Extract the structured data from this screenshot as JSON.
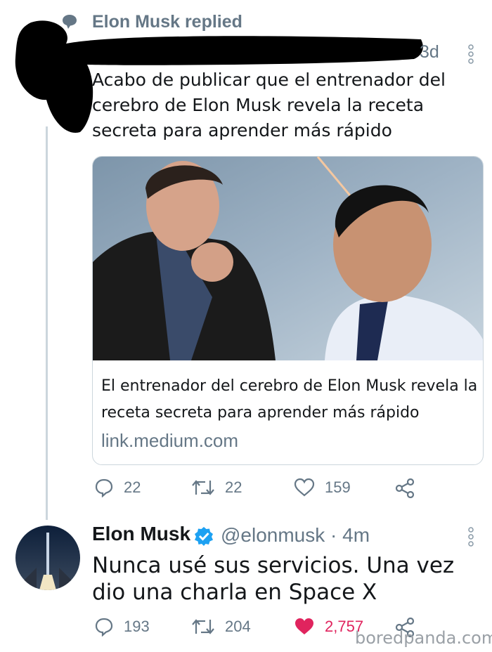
{
  "reply_header": {
    "label": "Elon Musk replied",
    "time": "3d"
  },
  "tweet1": {
    "text": "Acabo de publicar que el entrenador del cerebro de Elon Musk revela la receta secreta para aprender más rápido",
    "card": {
      "title": "El entrenador del cerebro de Elon Musk revela la receta secreta para aprender más rápido",
      "link": "link.medium.com"
    },
    "actions": {
      "replies": "22",
      "retweets": "22",
      "likes": "159"
    }
  },
  "tweet2": {
    "name": "Elon Musk",
    "handle_time": "@elonmusk · 4m",
    "text": "Nunca usé sus servicios. Una vez dio una charla en Space X",
    "actions": {
      "replies": "193",
      "retweets": "204",
      "likes": "2,757"
    }
  },
  "watermark": "boredpanda.com",
  "colors": {
    "muted": "#657786",
    "like_active": "#e0245e",
    "verified": "#1da1f2"
  }
}
